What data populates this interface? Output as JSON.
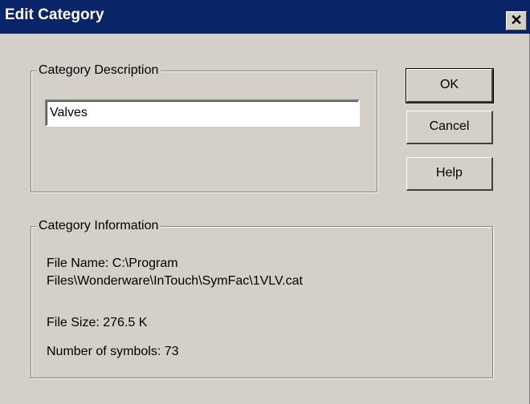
{
  "window": {
    "title": "Edit Category",
    "close_glyph": "✕"
  },
  "description_group": {
    "label": "Category Description",
    "input_value": "Valves"
  },
  "info_group": {
    "label": "Category Information",
    "file_name_line1": "File Name: C:\\Program",
    "file_name_line2": "Files\\Wonderware\\InTouch\\SymFac\\1VLV.cat",
    "file_size": "File Size: 276.5 K",
    "symbol_count": "Number of symbols: 73"
  },
  "buttons": {
    "ok": "OK",
    "cancel": "Cancel",
    "help": "Help"
  },
  "colors": {
    "titlebar": "#0a246a",
    "dialog_bg": "#d4d0c8"
  }
}
